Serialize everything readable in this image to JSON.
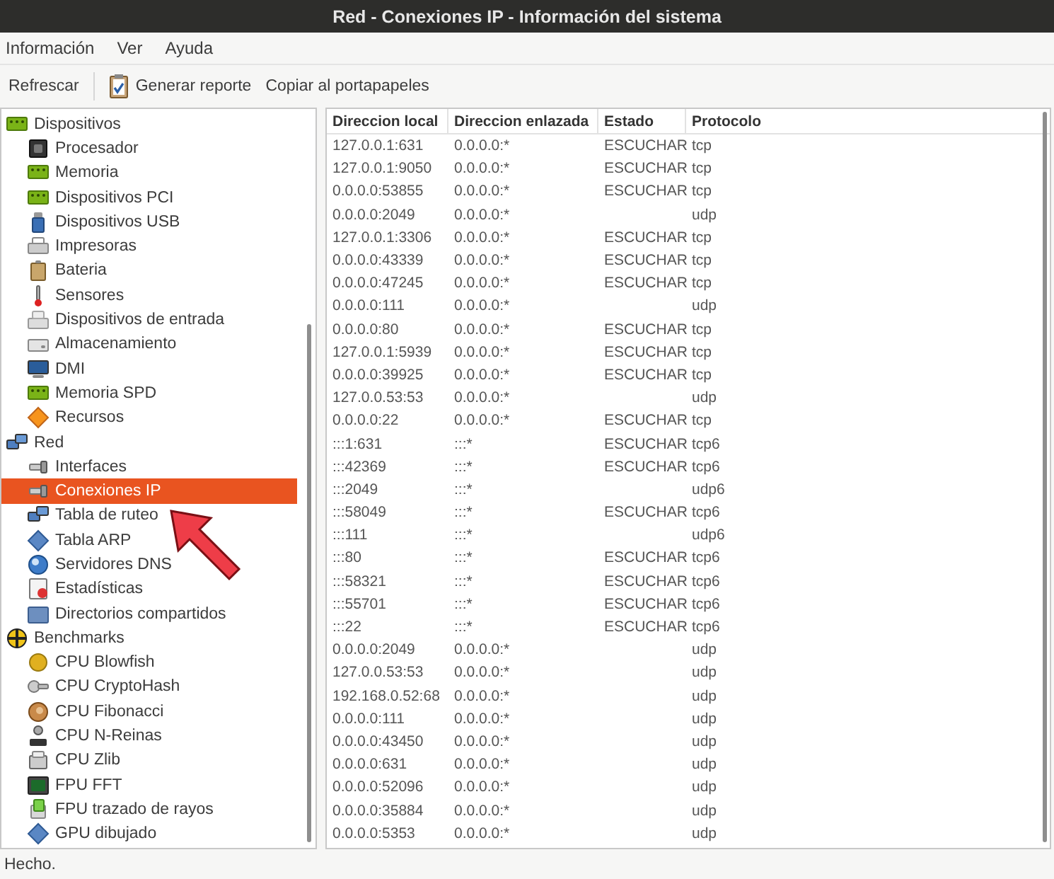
{
  "window": {
    "title": "Red - Conexiones IP - Información del sistema"
  },
  "menu": [
    "Información",
    "Ver",
    "Ayuda"
  ],
  "toolbar": [
    {
      "label": "Refrescar",
      "kind": "plain"
    },
    {
      "label": "Generar reporte",
      "kind": "icon"
    },
    {
      "label": "Copiar al portapapeles",
      "kind": "plain"
    }
  ],
  "sidebar": {
    "items": [
      {
        "label": "Dispositivos",
        "selected": false,
        "children": [
          {
            "label": "Procesador",
            "selected": false
          },
          {
            "label": "Memoria",
            "selected": false
          },
          {
            "label": "Dispositivos PCI",
            "selected": false
          },
          {
            "label": "Dispositivos USB",
            "selected": false
          },
          {
            "label": "Impresoras",
            "selected": false
          },
          {
            "label": "Bateria",
            "selected": false
          },
          {
            "label": "Sensores",
            "selected": false
          },
          {
            "label": "Dispositivos de entrada",
            "selected": false
          },
          {
            "label": "Almacenamiento",
            "selected": false
          },
          {
            "label": "DMI",
            "selected": false
          },
          {
            "label": "Memoria SPD",
            "selected": false
          },
          {
            "label": "Recursos",
            "selected": false
          }
        ]
      },
      {
        "label": "Red",
        "selected": false,
        "children": [
          {
            "label": "Interfaces",
            "selected": false
          },
          {
            "label": "Conexiones IP",
            "selected": true
          },
          {
            "label": "Tabla de ruteo",
            "selected": false
          },
          {
            "label": "Tabla ARP",
            "selected": false
          },
          {
            "label": "Servidores DNS",
            "selected": false
          },
          {
            "label": "Estadísticas",
            "selected": false
          },
          {
            "label": "Directorios compartidos",
            "selected": false
          }
        ]
      },
      {
        "label": "Benchmarks",
        "selected": false,
        "children": [
          {
            "label": "CPU Blowfish",
            "selected": false
          },
          {
            "label": "CPU CryptoHash",
            "selected": false
          },
          {
            "label": "CPU Fibonacci",
            "selected": false
          },
          {
            "label": "CPU N-Reinas",
            "selected": false
          },
          {
            "label": "CPU Zlib",
            "selected": false
          },
          {
            "label": "FPU FFT",
            "selected": false
          },
          {
            "label": "FPU trazado de rayos",
            "selected": false
          },
          {
            "label": "GPU dibujado",
            "selected": false
          }
        ]
      }
    ]
  },
  "table": {
    "columns": [
      "Direccion local",
      "Direccion enlazada",
      "Estado",
      "Protocolo"
    ],
    "rows": [
      [
        "127.0.0.1:631",
        "0.0.0.0:*",
        "ESCUCHAR",
        "tcp"
      ],
      [
        "127.0.0.1:9050",
        "0.0.0.0:*",
        "ESCUCHAR",
        "tcp"
      ],
      [
        "0.0.0.0:53855",
        "0.0.0.0:*",
        "ESCUCHAR",
        "tcp"
      ],
      [
        "0.0.0.0:2049",
        "0.0.0.0:*",
        null,
        "udp"
      ],
      [
        "127.0.0.1:3306",
        "0.0.0.0:*",
        "ESCUCHAR",
        "tcp"
      ],
      [
        "0.0.0.0:43339",
        "0.0.0.0:*",
        "ESCUCHAR",
        "tcp"
      ],
      [
        "0.0.0.0:47245",
        "0.0.0.0:*",
        "ESCUCHAR",
        "tcp"
      ],
      [
        "0.0.0.0:111",
        "0.0.0.0:*",
        null,
        "udp"
      ],
      [
        "0.0.0.0:80",
        "0.0.0.0:*",
        "ESCUCHAR",
        "tcp"
      ],
      [
        "127.0.0.1:5939",
        "0.0.0.0:*",
        "ESCUCHAR",
        "tcp"
      ],
      [
        "0.0.0.0:39925",
        "0.0.0.0:*",
        "ESCUCHAR",
        "tcp"
      ],
      [
        "127.0.0.53:53",
        "0.0.0.0:*",
        null,
        "udp"
      ],
      [
        "0.0.0.0:22",
        "0.0.0.0:*",
        "ESCUCHAR",
        "tcp"
      ],
      [
        ":::1:631",
        ":::*",
        "ESCUCHAR",
        "tcp6"
      ],
      [
        ":::42369",
        ":::*",
        "ESCUCHAR",
        "tcp6"
      ],
      [
        ":::2049",
        ":::*",
        null,
        "udp6"
      ],
      [
        ":::58049",
        ":::*",
        "ESCUCHAR",
        "tcp6"
      ],
      [
        ":::111",
        ":::*",
        null,
        "udp6"
      ],
      [
        ":::80",
        ":::*",
        "ESCUCHAR",
        "tcp6"
      ],
      [
        ":::58321",
        ":::*",
        "ESCUCHAR",
        "tcp6"
      ],
      [
        ":::55701",
        ":::*",
        "ESCUCHAR",
        "tcp6"
      ],
      [
        ":::22",
        ":::*",
        "ESCUCHAR",
        "tcp6"
      ],
      [
        "0.0.0.0:2049",
        "0.0.0.0:*",
        null,
        "udp"
      ],
      [
        "127.0.0.53:53",
        "0.0.0.0:*",
        null,
        "udp"
      ],
      [
        "192.168.0.52:68",
        "0.0.0.0:*",
        null,
        "udp"
      ],
      [
        "0.0.0.0:111",
        "0.0.0.0:*",
        null,
        "udp"
      ],
      [
        "0.0.0.0:43450",
        "0.0.0.0:*",
        null,
        "udp"
      ],
      [
        "0.0.0.0:631",
        "0.0.0.0:*",
        null,
        "udp"
      ],
      [
        "0.0.0.0:52096",
        "0.0.0.0:*",
        null,
        "udp"
      ],
      [
        "0.0.0.0:35884",
        "0.0.0.0:*",
        null,
        "udp"
      ],
      [
        "0.0.0.0:5353",
        "0.0.0.0:*",
        null,
        "udp"
      ]
    ]
  },
  "status_bar": "Hecho."
}
